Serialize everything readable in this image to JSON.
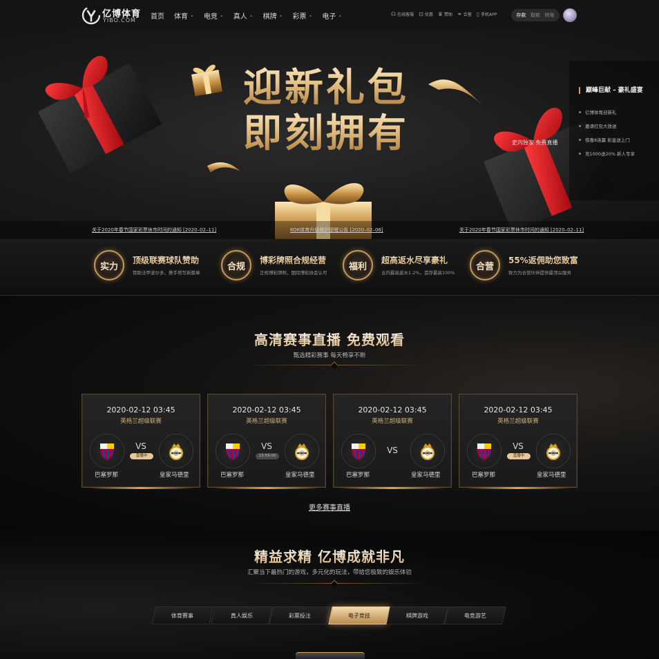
{
  "brand": {
    "name_cn": "亿博体育",
    "name_en": "YIBO.COM"
  },
  "nav": {
    "menu": [
      {
        "label": "首页",
        "dropdown": false
      },
      {
        "label": "体育",
        "dropdown": true
      },
      {
        "label": "电竞",
        "dropdown": true
      },
      {
        "label": "真人",
        "dropdown": true
      },
      {
        "label": "棋牌",
        "dropdown": true
      },
      {
        "label": "彩票",
        "dropdown": true
      },
      {
        "label": "电子",
        "dropdown": true
      }
    ],
    "utilities": [
      {
        "label": "在线客服",
        "icon": "headset-icon"
      },
      {
        "label": "优惠",
        "icon": "gift-icon"
      },
      {
        "label": "赞助",
        "icon": "trophy-icon"
      },
      {
        "label": "合营",
        "icon": "handshake-icon"
      },
      {
        "label": "手机APP",
        "icon": "phone-icon"
      }
    ],
    "account": {
      "deposit": "存款",
      "withdraw": "取款",
      "transfer": "转账"
    }
  },
  "hero": {
    "title_line1": "迎新礼包",
    "title_line2": "即刻拥有",
    "subtitle": "史内独家 免费直播",
    "promo": {
      "title": "巅峰巨献 – 豪礼盛宴",
      "items": [
        "亿博体育迎新礼",
        "邀请红包大放送",
        "惊喜8连赢 彩金送上门",
        "充1000送20% 新人专享"
      ]
    },
    "ticker": [
      "关于2020年春节国家彩票休市时间的通知 [2020–02–11]",
      "KOK体育升级维护提醒公告 [2020–02–06]",
      "关于2020年春节国家彩票休市时间的通知 [2020–02–11]"
    ]
  },
  "features": [
    {
      "badge": "实力",
      "title": "顶级联赛球队赞助",
      "desc": "赞助法甲波尔多，携手塔写新篇章"
    },
    {
      "badge": "合规",
      "title": "博彩牌照合规经营",
      "desc": "正规博彩牌照，国际博彩协会认可"
    },
    {
      "badge": "福利",
      "title": "超高返水尽享豪礼",
      "desc": "业内最高返水1.2%，首存最高100%"
    },
    {
      "badge": "合营",
      "title": "55%返佣助您致富",
      "desc": "致力为合营伙伴提供最顶尖服务"
    }
  ],
  "live_section": {
    "title": "高清赛事直播 免费观看",
    "subtitle": "甄选精彩赛事 每天畅享不断",
    "matches": [
      {
        "time": "2020-02-12 03:45",
        "league": "英格兰超级联赛",
        "home": "巴塞罗那",
        "away": "皇家马德里",
        "vs": "VS",
        "status": "直播中",
        "status_type": "live"
      },
      {
        "time": "2020-02-12 03:45",
        "league": "英格兰超级联赛",
        "home": "巴塞罗那",
        "away": "皇家马德里",
        "vs": "VS",
        "status": "23:59:00",
        "status_type": "countdown"
      },
      {
        "time": "2020-02-12 03:45",
        "league": "英格兰超级联赛",
        "home": "巴塞罗那",
        "away": "皇家马德里",
        "vs": "VS",
        "status": "",
        "status_type": "none"
      },
      {
        "time": "2020-02-12 03:45",
        "league": "英格兰超级联赛",
        "home": "巴塞罗那",
        "away": "皇家马德里",
        "vs": "VS",
        "status": "直播中",
        "status_type": "live"
      }
    ],
    "more_link": "更多赛事直播"
  },
  "games_section": {
    "title": "精益求精 亿博成就非凡",
    "subtitle": "汇聚当下最热门的游戏，多元化的玩法，带给您极致的娱乐体验",
    "tabs": [
      "体育赛事",
      "真人娱乐",
      "彩票投注",
      "电子竞技",
      "棋牌游戏",
      "电竞游艺"
    ],
    "active_tab": 3
  },
  "colors": {
    "gold": "#d7a25a",
    "gold_light": "#f3d9ad",
    "ribbon_red": "#d3101a",
    "background": "#0b0b0b"
  }
}
